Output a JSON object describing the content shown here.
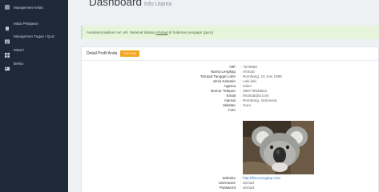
{
  "sidebar": {
    "items": [
      {
        "label": "Manajemen Kelas",
        "icon": "square-icon"
      },
      {
        "label": "Mata Pelajaran",
        "icon": "book-icon"
      },
      {
        "label": "Manajemen Tugas / Quiz",
        "icon": "list-icon"
      },
      {
        "label": "Materi",
        "icon": "grid-icon"
      },
      {
        "label": "Berita",
        "icon": "newspaper-icon"
      }
    ]
  },
  "header": {
    "title": "Dashboard",
    "subtitle": "Info Utama"
  },
  "alert": {
    "greeting": "Assalamu'alaikum wr. wb.",
    "text_before": " ",
    "welcome": "Selamat datang",
    "name": "Ahmad",
    "text_mid": " di halaman ",
    "role": "pengajar (guru)"
  },
  "profile": {
    "title": "Detail Profil Anda",
    "edit_button": "Edit Profil",
    "fields": [
      {
        "label": "NIP",
        "value": "7676656"
      },
      {
        "label": "Nama Lengkap",
        "value": "Ahmad"
      },
      {
        "label": "Tempat Tanggal Lahir",
        "value": "Rembang, 10 Juni 1989"
      },
      {
        "label": "Jenis Kelamin",
        "value": "Laki-laki"
      },
      {
        "label": "Agama",
        "value": "Islam"
      },
      {
        "label": "Nomor Telepon",
        "value": "0867785365xx"
      },
      {
        "label": "Email",
        "value": "hhuhdd@d.com"
      },
      {
        "label": "Alamat",
        "value": "Rembang, Indonesia"
      },
      {
        "label": "Jabatan",
        "value": "Guru"
      },
      {
        "label": "Foto",
        "value": ""
      }
    ],
    "fields_after": [
      {
        "label": "Website",
        "value": "http://ilmu.lengkap.com"
      },
      {
        "label": "Username",
        "value": "ahmad"
      },
      {
        "label": "Password",
        "value": "ahmad"
      }
    ],
    "photo_subject": "koala"
  },
  "colors": {
    "sidebar": "#1d2939",
    "alert_bg": "#e7f4dc",
    "edit_button": "#f5a623",
    "link": "#3a74c4"
  }
}
